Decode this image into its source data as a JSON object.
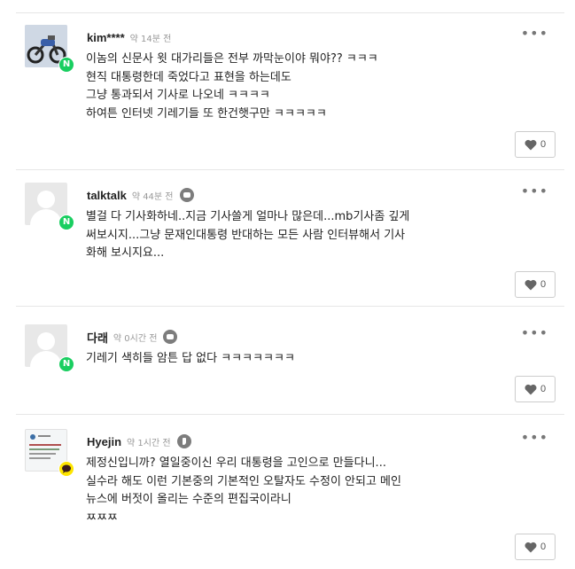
{
  "comments": [
    {
      "nickname": "kim****",
      "time": "약 14분 전",
      "source_icon": "none",
      "badge": "naver",
      "badge_text": "N",
      "text": "이놈의 신문사 윗 대가리들은 전부 까막눈이야 뭐야?? ㅋㅋㅋ\n현직 대통령한데 죽었다고 표현을 하는데도\n그냥 통과되서 기사로 나오네 ㅋㅋㅋㅋ\n하여튼  인터넷 기레기들 또 한건햇구만 ㅋㅋㅋㅋㅋ",
      "more": "•••",
      "likes": "0"
    },
    {
      "nickname": "talktalk",
      "time": "약 44분 전",
      "source_icon": "chat-icon",
      "badge": "naver",
      "badge_text": "N",
      "text": "별걸 다 기사화하네..지금 기사쓸게 얼마나 많은데...mb기사좀 깊게\n써보시지...그냥 문재인대통령 반대하는 모든 사람 인터뷰해서 기사\n화해 보시지요...",
      "more": "•••",
      "likes": "0"
    },
    {
      "nickname": "다래",
      "time": "약 0시간 전",
      "source_icon": "chat-icon",
      "badge": "naver",
      "badge_text": "N",
      "text": "기레기 색히들 암튼 답 없다 ㅋㅋㅋㅋㅋㅋㅋ",
      "more": "•••",
      "likes": "0"
    },
    {
      "nickname": "Hyejin",
      "time": "약 1시간 전",
      "source_icon": "quote-icon",
      "badge": "kakao",
      "badge_text": "",
      "text": "제정신입니까? 열일중이신 우리 대통령을 고인으로 만들다니...\n실수라 해도 이런 기본중의 기본적인 오탈자도 수정이 안되고 메인\n뉴스에 버젓이 올리는 수준의 편집국이라니\nㅉㅉㅉ",
      "more": "•••",
      "likes": "0"
    }
  ],
  "colors": {
    "naver_green": "#19ce60",
    "kakao_yellow": "#fee500",
    "divider": "#e6e6e6"
  }
}
